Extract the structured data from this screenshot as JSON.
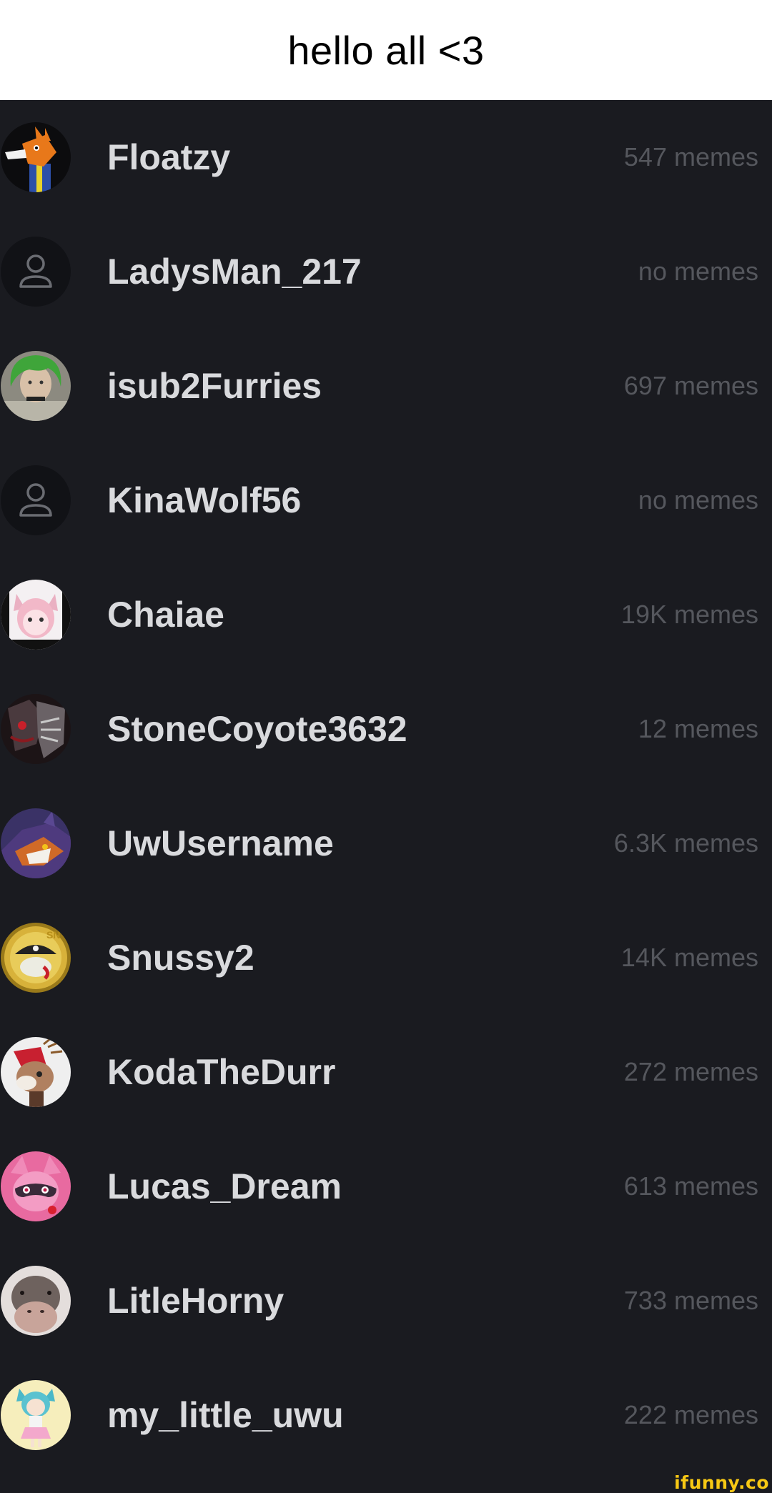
{
  "caption": "hello all <3",
  "users": [
    {
      "username": "Floatzy",
      "memes": "547 memes",
      "avatar": "fox-character-avatar"
    },
    {
      "username": "LadysMan_217",
      "memes": "no memes",
      "avatar": "default-user-icon"
    },
    {
      "username": "isub2Furries",
      "memes": "697 memes",
      "avatar": "green-hair-avatar"
    },
    {
      "username": "KinaWolf56",
      "memes": "no memes",
      "avatar": "default-user-icon"
    },
    {
      "username": "Chaiae",
      "memes": "19K memes",
      "avatar": "pink-anime-avatar"
    },
    {
      "username": "StoneCoyote3632",
      "memes": "12 memes",
      "avatar": "dark-creature-avatar"
    },
    {
      "username": "UwUsername",
      "memes": "6.3K memes",
      "avatar": "purple-dragon-avatar"
    },
    {
      "username": "Snussy2",
      "memes": "14K memes",
      "avatar": "gold-pirate-coin-avatar"
    },
    {
      "username": "KodaTheDurr",
      "memes": "272 memes",
      "avatar": "deer-character-avatar"
    },
    {
      "username": "Lucas_Dream",
      "memes": "613 memes",
      "avatar": "pink-raccoon-avatar"
    },
    {
      "username": "LitleHorny",
      "memes": "733 memes",
      "avatar": "hippo-face-avatar"
    },
    {
      "username": "my_little_uwu",
      "memes": "222 memes",
      "avatar": "anime-girl-avatar"
    }
  ],
  "watermark": "ifunny.co",
  "colors": {
    "background": "#1a1b20",
    "username": "#d9dadd",
    "count": "#55575d",
    "watermark": "#f7c814"
  }
}
